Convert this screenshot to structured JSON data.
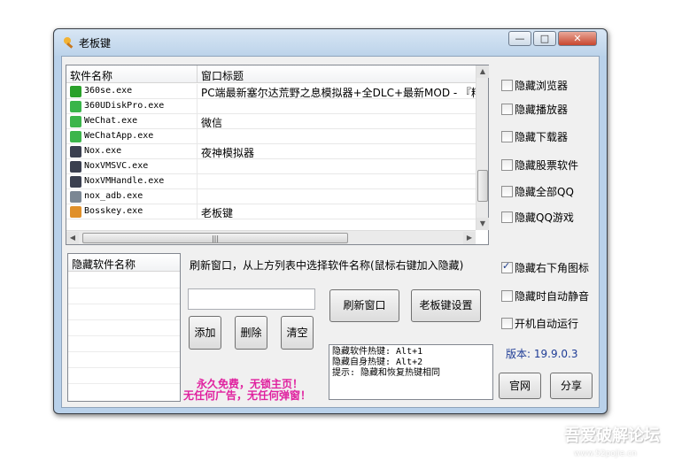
{
  "window": {
    "title": "老板键"
  },
  "controls": {
    "minimize": "—",
    "maximize": "□",
    "close": "✕"
  },
  "listview": {
    "headers": [
      "软件名称",
      "窗口标题"
    ],
    "rows": [
      {
        "name": "360se.exe",
        "title": "PC端最新塞尔达荒野之息模拟器+全DLC+最新MOD -  『精品",
        "icon": "ie-icon",
        "color": "#2aa12a"
      },
      {
        "name": "360UDiskPro.exe",
        "title": "",
        "icon": "usb-icon",
        "color": "#39b54a"
      },
      {
        "name": "WeChat.exe",
        "title": "微信",
        "icon": "wechat-icon",
        "color": "#3bb54a"
      },
      {
        "name": "WeChatApp.exe",
        "title": "",
        "icon": "wechat-app-icon",
        "color": "#3bb54a"
      },
      {
        "name": "Nox.exe",
        "title": "夜神模拟器",
        "icon": "nox-icon",
        "color": "#3a3f4f"
      },
      {
        "name": "NoxVMSVC.exe",
        "title": "",
        "icon": "nox-icon",
        "color": "#3a3f4f"
      },
      {
        "name": "NoxVMHandle.exe",
        "title": "",
        "icon": "nox-icon",
        "color": "#3a3f4f"
      },
      {
        "name": "nox_adb.exe",
        "title": "",
        "icon": "console-icon",
        "color": "#7b8794"
      },
      {
        "name": "Bosskey.exe",
        "title": "老板键",
        "icon": "bosskey-icon",
        "color": "#e0902a"
      }
    ]
  },
  "checkboxes": [
    {
      "label": "隐藏浏览器",
      "checked": false
    },
    {
      "label": "隐藏播放器",
      "checked": false
    },
    {
      "label": "隐藏下载器",
      "checked": false
    },
    {
      "label": "隐藏股票软件",
      "checked": false
    },
    {
      "label": "隐藏全部QQ",
      "checked": false
    },
    {
      "label": "隐藏QQ游戏",
      "checked": false
    },
    {
      "label": "隐藏右下角图标",
      "checked": true
    },
    {
      "label": "隐藏时自动静音",
      "checked": false
    },
    {
      "label": "开机自动运行",
      "checked": false
    }
  ],
  "hidden_list": {
    "header": "隐藏软件名称"
  },
  "hint": "刷新窗口，从上方列表中选择软件名称(鼠标右键加入隐藏)",
  "buttons": {
    "add": "添加",
    "delete": "删除",
    "clear": "清空",
    "refresh": "刷新窗口",
    "settings": "老板键设置",
    "website": "官网",
    "share": "分享"
  },
  "info_text": [
    "隐藏软件热键: Alt+1",
    "隐藏自身热键: Alt+2",
    "提示: 隐藏和恢复热键相同"
  ],
  "slogan": [
    "永久免费，无锁主页！",
    "无任何广告，无任何弹窗！"
  ],
  "version": "版本: 19.9.0.3",
  "watermark": {
    "line1": "吾爱破解论坛",
    "line2": "www.52pojie.cn"
  }
}
